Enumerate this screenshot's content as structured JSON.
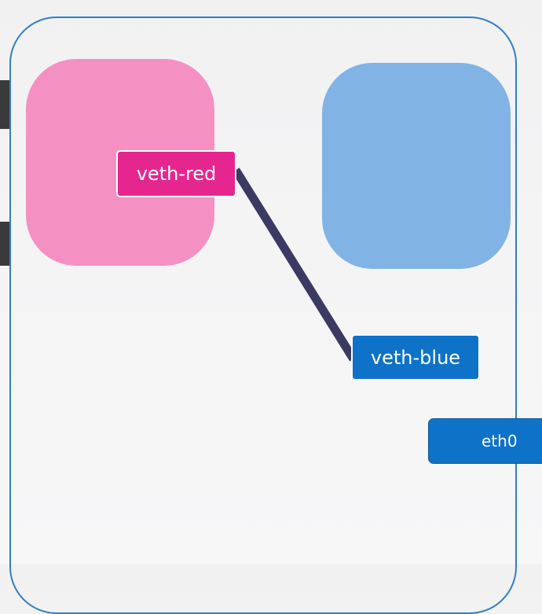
{
  "colors": {
    "host_border": "#2f7fc5",
    "red_namespace": "#f590c2",
    "blue_namespace": "#81b4e4",
    "veth_red": "#e6268f",
    "veth_blue": "#0e72c9",
    "eth0": "#0e72c9",
    "cable": "#3b3a63"
  },
  "interfaces": {
    "veth_red": "veth-red",
    "veth_blue": "veth-blue",
    "eth0": "eth0"
  }
}
